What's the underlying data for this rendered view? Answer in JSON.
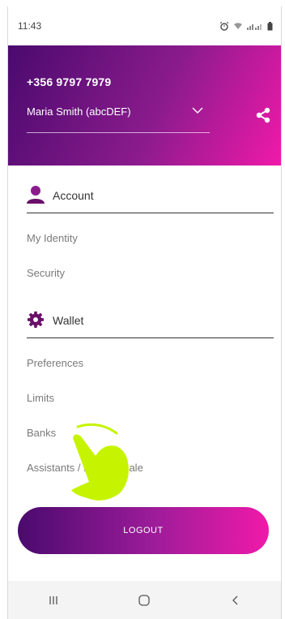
{
  "status_bar": {
    "time": "11:43",
    "icons": [
      "alarm-icon",
      "wifi-icon",
      "signal-icon",
      "battery-icon"
    ]
  },
  "header": {
    "phone_number": "+356 9797 7979",
    "account_selector": "Maria Smith (abcDEF)",
    "chevron_icon": "chevron-down-icon",
    "share_icon": "share-icon",
    "gradient_colors": [
      "#4a0a6e",
      "#f01aa9"
    ]
  },
  "menu": {
    "account": {
      "title": "Account",
      "icon": "person-icon",
      "items": [
        {
          "label": "My Identity"
        },
        {
          "label": "Security"
        }
      ]
    },
    "wallet": {
      "title": "Wallet",
      "icon": "gear-icon",
      "items": [
        {
          "label": "Preferences"
        },
        {
          "label": "Limits"
        },
        {
          "label": "Banks"
        },
        {
          "label": "Assistants / Point of Sale"
        }
      ]
    }
  },
  "logout_label": "LOGOUT",
  "nav_bar": {
    "icons": [
      "recent-apps-icon",
      "home-icon",
      "back-icon"
    ]
  },
  "overlay": {
    "icon": "tap-hand-icon",
    "color": "#c6f400"
  },
  "colors": {
    "accent": "#8b1b8d",
    "pink": "#f01aa9",
    "purple": "#4a0a6e",
    "icon": "#6a0f6a"
  }
}
